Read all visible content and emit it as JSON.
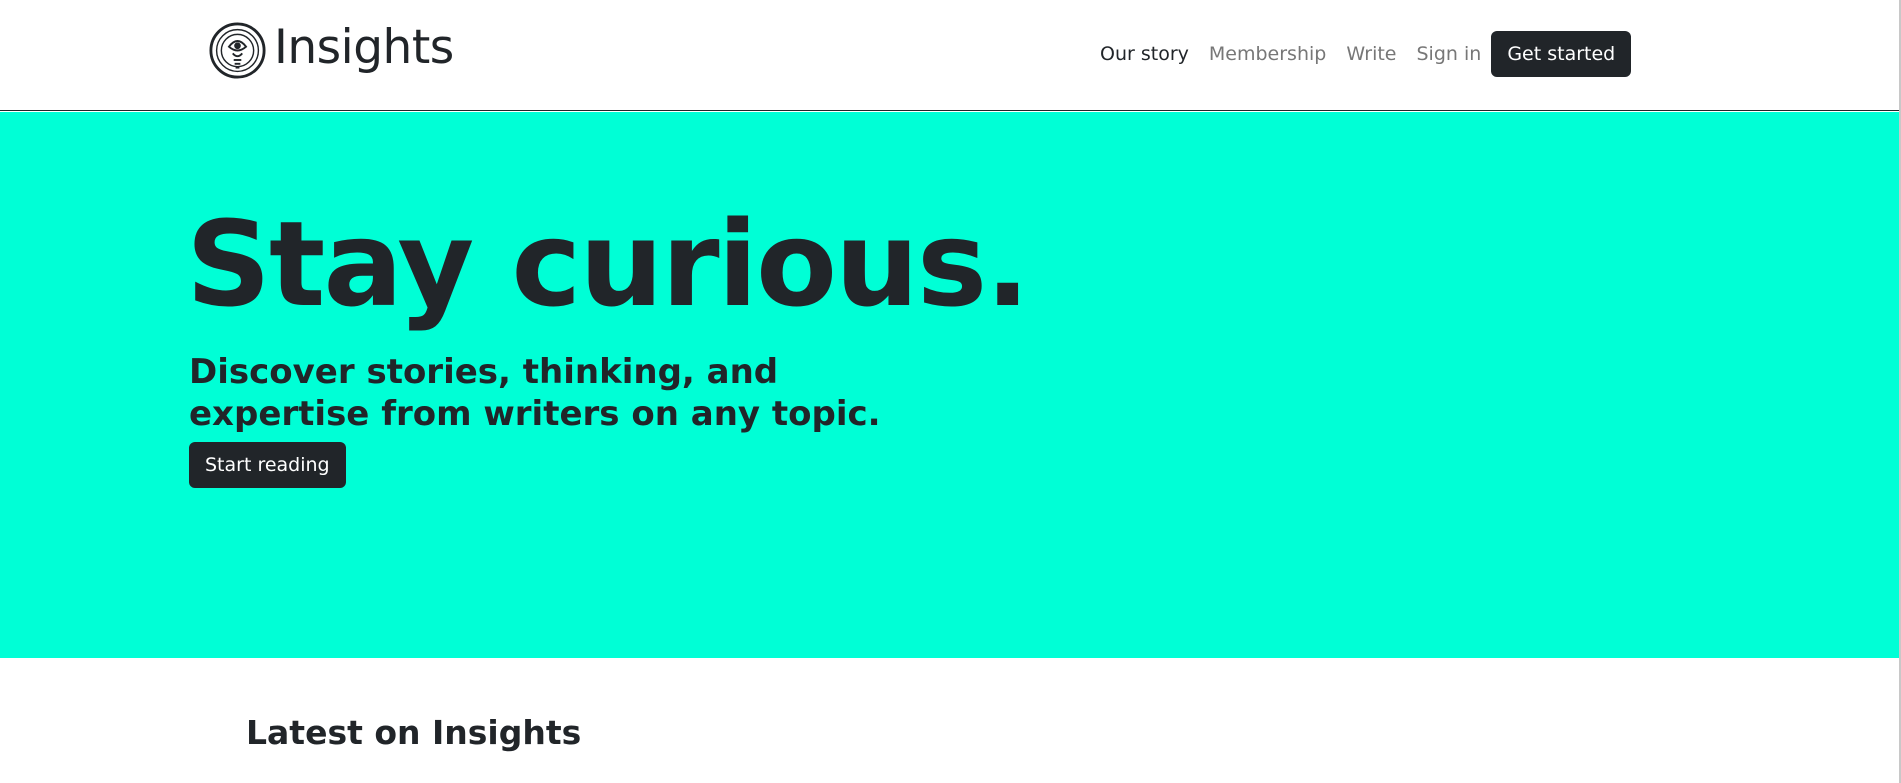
{
  "brand": {
    "name": "Insights",
    "logo_icon": "lightbulb-eye-icon"
  },
  "nav": {
    "items": [
      {
        "label": "Our story",
        "active": true
      },
      {
        "label": "Membership",
        "active": false
      },
      {
        "label": "Write",
        "active": false
      },
      {
        "label": "Sign in",
        "active": false
      }
    ],
    "cta_label": "Get started"
  },
  "hero": {
    "title": "Stay curious.",
    "subtitle": "Discover stories, thinking, and expertise from writers on any topic.",
    "cta_label": "Start reading",
    "background": "#00ffd6"
  },
  "latest": {
    "heading": "Latest on Insights"
  },
  "colors": {
    "text_dark": "#212529",
    "nav_muted": "#777777",
    "button_bg": "#212529",
    "button_text": "#ffffff",
    "accent": "#00ffd6"
  }
}
